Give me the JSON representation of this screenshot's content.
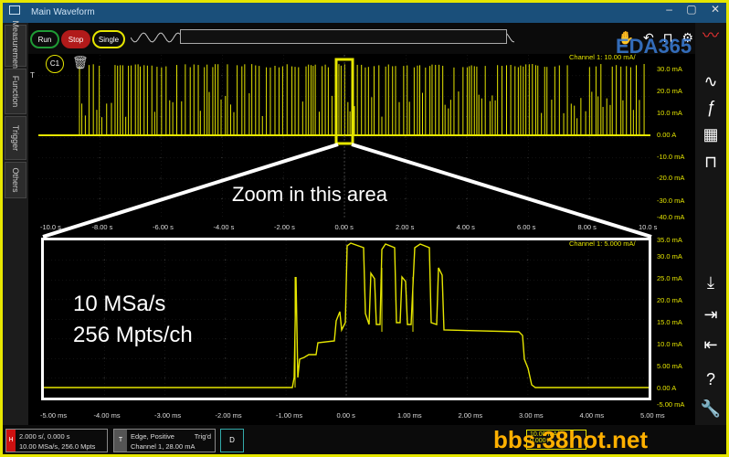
{
  "window": {
    "tab_title": "Main Waveform",
    "controls": [
      "–",
      "▢",
      "✕"
    ]
  },
  "left_tabs": [
    "Measurement",
    "Function",
    "Trigger",
    "Others"
  ],
  "toolbar": {
    "run": "Run",
    "stop": "Stop",
    "single": "Single"
  },
  "logo_text": "EDA365",
  "upper_plot": {
    "channel_info": "Channel 1:  10.00 mA/",
    "channel_badge": "C1",
    "trigger_marker": "T",
    "y_labels": [
      "30.0 mA",
      "20.0 mA",
      "10.0 mA",
      "0.00 A",
      "-10.0 mA",
      "-20.0 mA",
      "-30.0 mA",
      "-40.0 mA"
    ],
    "x_labels": [
      "-10.0 s",
      "-8.00 s",
      "-6.00 s",
      "-4.00 s",
      "-2.00 s",
      "0.00 s",
      "2.00 s",
      "4.00 s",
      "6.00 s",
      "8.00 s",
      "10.0 s"
    ]
  },
  "annotation_zoom": "Zoom in this area",
  "lower_plot": {
    "channel_info": "Channel 1:  5.000 mA/",
    "y_labels": [
      "35.0 mA",
      "30.0 mA",
      "25.0 mA",
      "20.0 mA",
      "15.0 mA",
      "10.0 mA",
      "5.00 mA",
      "0.00 A",
      "-5.00 mA"
    ],
    "x_labels": [
      "-5.00 ms",
      "-4.00 ms",
      "-3.00 ms",
      "-2.00 ms",
      "-1.00 ms",
      "0.00 s",
      "1.00 ms",
      "2.00 ms",
      "3.00 ms",
      "4.00 ms",
      "5.00 ms"
    ]
  },
  "annotation_rate": [
    "10 MSa/s",
    "256 Mpts/ch"
  ],
  "status": {
    "horizontal_tag": "H",
    "horizontal_line1": "2.000 s/, 0.000 s",
    "horizontal_line2": "10.00 MSa/s, 256.0 Mpts",
    "trigger_tag": "T",
    "trigger_line1": "Edge, Positive",
    "trigger_state": "Trig'd",
    "trigger_line2": "Channel 1, 28.00 mA",
    "digital_tag": "D",
    "ch_scale": "10.00 mA/",
    "ch_offset": "0.000 A"
  },
  "watermark": "bbs.38hot.net",
  "colors": {
    "trace": "#e6e600",
    "frame": "#e6e600",
    "titlebar": "#1a4f7a",
    "stop": "#b11a1a",
    "run": "#1f9b35"
  }
}
